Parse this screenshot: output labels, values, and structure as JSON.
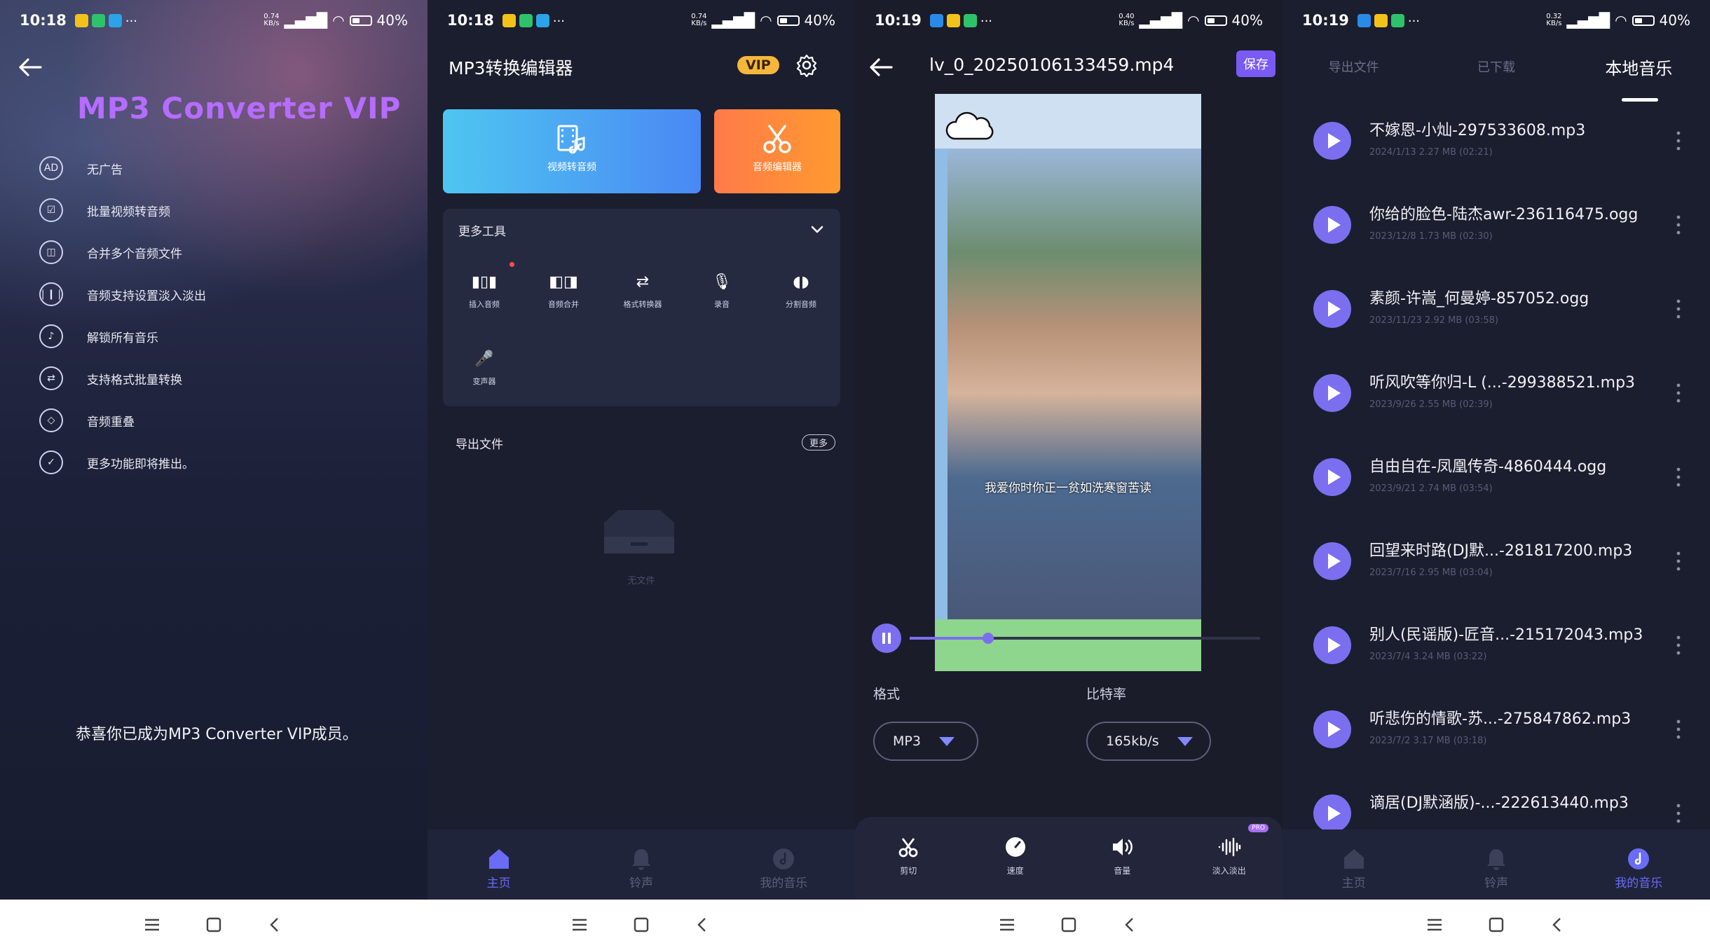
{
  "status_bars": [
    {
      "time": "10:18",
      "speed": "0.74\nKB/s",
      "battery": "40"
    },
    {
      "time": "10:18",
      "speed": "0.74\nKB/s",
      "battery": "40"
    },
    {
      "time": "10:19",
      "speed": "0.40\nKB/s",
      "battery": "40"
    },
    {
      "time": "10:19",
      "speed": "0.32\nKB/s",
      "battery": "40"
    }
  ],
  "vip": {
    "title": "MP3 Converter VIP",
    "features": [
      {
        "icon": "no-ads-icon",
        "glyph": "AD",
        "label": "无广告"
      },
      {
        "icon": "batch-convert-icon",
        "glyph": "☑",
        "label": "批量视频转音频"
      },
      {
        "icon": "merge-icon",
        "glyph": "◫",
        "label": "合并多个音频文件"
      },
      {
        "icon": "fade-icon",
        "glyph": "❘❙❘",
        "label": "音频支持设置淡入淡出"
      },
      {
        "icon": "music-note-icon",
        "glyph": "♪",
        "label": "解锁所有音乐"
      },
      {
        "icon": "format-convert-icon",
        "glyph": "⇄",
        "label": "支持格式批量转换"
      },
      {
        "icon": "layers-icon",
        "glyph": "◇",
        "label": "音频重叠"
      },
      {
        "icon": "check-icon",
        "glyph": "✓",
        "label": "更多功能即将推出。"
      }
    ],
    "congrats": "恭喜你已成为MP3 Converter VIP成员。"
  },
  "editor": {
    "title": "MP3转换编辑器",
    "vip_badge": "VIP",
    "card_video": "视频转音频",
    "card_audio": "音频编辑器",
    "more_tools": "更多工具",
    "tools": [
      "插入音频",
      "音频合并",
      "格式转换器",
      "录音",
      "分割音频",
      "变声器"
    ],
    "export_label": "导出文件",
    "more_button": "更多",
    "empty": "无文件"
  },
  "bottom_tabs": [
    "主页",
    "铃声",
    "我的音乐"
  ],
  "player": {
    "filename": "lv_0_20250106133459.mp4",
    "save": "保存",
    "subtitle": "我爱你时你正一贫如洗寒窗苦读",
    "format_label": "格式",
    "bitrate_label": "比特率",
    "format_value": "MP3",
    "bitrate_value": "165kb/s",
    "controls": [
      "剪切",
      "速度",
      "音量",
      "淡入淡出"
    ],
    "pro": "PRO"
  },
  "music": {
    "tabs": [
      "导出文件",
      "已下载",
      "本地音乐"
    ],
    "songs": [
      {
        "title": "不嫁恩-小灿-297533608.mp3",
        "meta": "2024/1/13    2.27 MB (02:21)"
      },
      {
        "title": "你给的脸色-陆杰awr-236116475.ogg",
        "meta": "2023/12/8    1.73 MB (02:30)"
      },
      {
        "title": "素颜-许嵩_何曼婷-857052.ogg",
        "meta": "2023/11/23    2.92 MB (03:58)"
      },
      {
        "title": "听风吹等你归-L (...-299388521.mp3",
        "meta": "2023/9/26    2.55 MB (02:39)"
      },
      {
        "title": "自由自在-凤凰传奇-4860444.ogg",
        "meta": "2023/9/21    2.74 MB (03:54)"
      },
      {
        "title": "回望来时路(DJ默...-281817200.mp3",
        "meta": "2023/7/16    2.95 MB (03:04)"
      },
      {
        "title": "别人(民谣版)-匠音...-215172043.mp3",
        "meta": "2023/7/4    3.24 MB (03:22)"
      },
      {
        "title": "听悲伤的情歌-苏...-275847862.mp3",
        "meta": "2023/7/2    3.17 MB (03:18)"
      },
      {
        "title": "谪居(DJ默涵版)-...-222613440.mp3",
        "meta": ""
      }
    ]
  },
  "colors": {
    "accent": "#7b6ff0",
    "vip_purple": "#b56cff",
    "orange": "#ff8a3a",
    "blue": "#4aa6f3"
  }
}
